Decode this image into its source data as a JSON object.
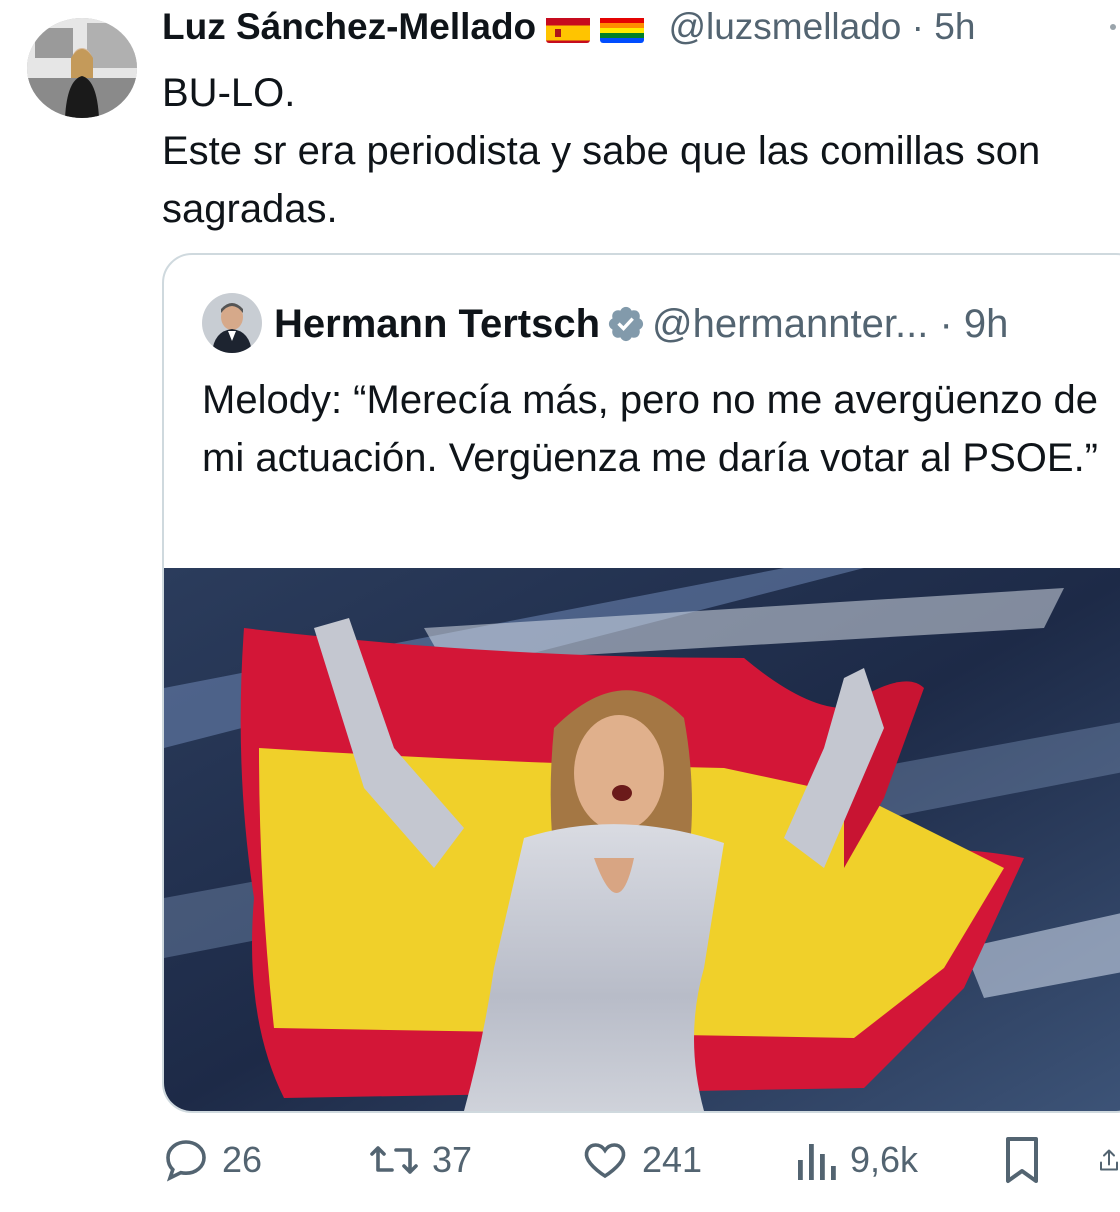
{
  "author": {
    "name": "Luz Sánchez-Mellado",
    "handle": "@luzsmellado",
    "time": "· 5h",
    "flags": [
      "spain-flag-icon",
      "rainbow-flag-icon"
    ]
  },
  "tweet": {
    "lines": [
      "BU-LO.",
      "Este sr era periodista y sabe que las comillas son sagradas."
    ]
  },
  "quoted": {
    "name": "Hermann Tertsch",
    "handle": "@hermannter...",
    "time": "· 9h",
    "text": "Melody: “Merecía más, pero no me avergüenzo de mi actuación. Vergüenza me daría votar al PSOE.”",
    "image_alt": "Performer in a sequined outfit holding a Spanish flag on stage"
  },
  "actions": {
    "replies": "26",
    "reposts": "37",
    "likes": "241",
    "views": "9,6k"
  },
  "colors": {
    "text": "#0f1419",
    "muted": "#536471",
    "border": "#cfd9de",
    "verified": "#829aab"
  }
}
